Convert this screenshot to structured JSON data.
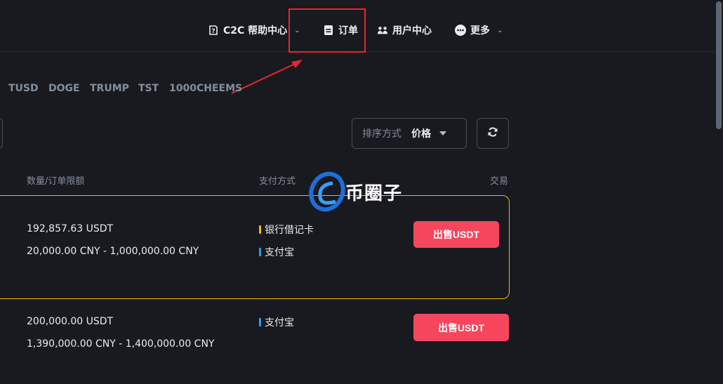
{
  "nav": {
    "help": {
      "label": "C2C 帮助中心",
      "icon": "help-icon"
    },
    "orders": {
      "label": "订单",
      "icon": "document-icon"
    },
    "user_center": {
      "label": "用户中心",
      "icon": "users-icon"
    },
    "more": {
      "label": "更多",
      "icon": "more-dots-icon"
    }
  },
  "coins": [
    "TUSD",
    "DOGE",
    "TRUMP",
    "TST",
    "1000CHEEMS"
  ],
  "sort": {
    "label": "排序方式",
    "value": "价格"
  },
  "table_headers": {
    "amount_limit": "数量/订单限额",
    "payment": "支付方式",
    "trade": "交易"
  },
  "rows": [
    {
      "amount": "192,857.63 USDT",
      "limit": "20,000.00 CNY - 1,000,000.00 CNY",
      "payments": [
        {
          "name": "银行借记卡",
          "color": "#f0b90b"
        },
        {
          "name": "支付宝",
          "color": "#2e9bf0"
        }
      ],
      "action": "出售USDT"
    },
    {
      "amount": "200,000.00 USDT",
      "limit": "1,390,000.00 CNY - 1,400,000.00 CNY",
      "payments": [
        {
          "name": "支付宝",
          "color": "#2e9bf0"
        }
      ],
      "action": "出售USDT"
    }
  ],
  "watermark": {
    "text": "币圈子"
  },
  "colors": {
    "background": "#181a20",
    "highlight": "#e8262a",
    "sell": "#f6465d",
    "selected_border": "#f0b90b"
  }
}
